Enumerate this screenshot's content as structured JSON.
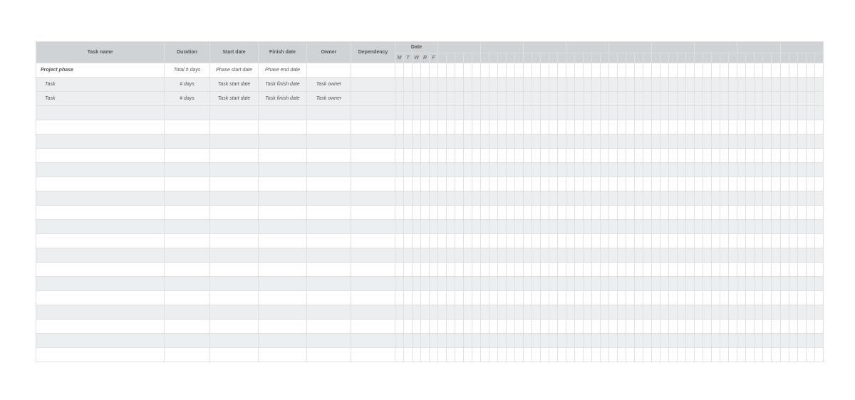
{
  "headers": {
    "task": "Task name",
    "duration": "Duration",
    "start": "Start date",
    "finish": "Finish date",
    "owner": "Owner",
    "dependency": "Dependency",
    "date": "Date"
  },
  "days": [
    "M",
    "T",
    "W",
    "R",
    "F"
  ],
  "rows": [
    {
      "type": "phase",
      "task": "Project phase",
      "duration": "Total # days",
      "start": "Phase start date",
      "finish": "Phase end date",
      "owner": "",
      "bar_start": -1,
      "bar_end": -1
    },
    {
      "type": "task",
      "task": "Task",
      "duration": "# days",
      "start": "Task start date",
      "finish": "Task finish date",
      "owner": "Task owner",
      "bar_start": 0,
      "bar_end": 2
    },
    {
      "type": "task",
      "task": "Task",
      "duration": "# days",
      "start": "Task start date",
      "finish": "Task finish date",
      "owner": "Task owner",
      "bar_start": 3,
      "bar_end": 4
    }
  ],
  "blank_rows": 18,
  "weeks_visible": 10,
  "days_per_week": 5
}
